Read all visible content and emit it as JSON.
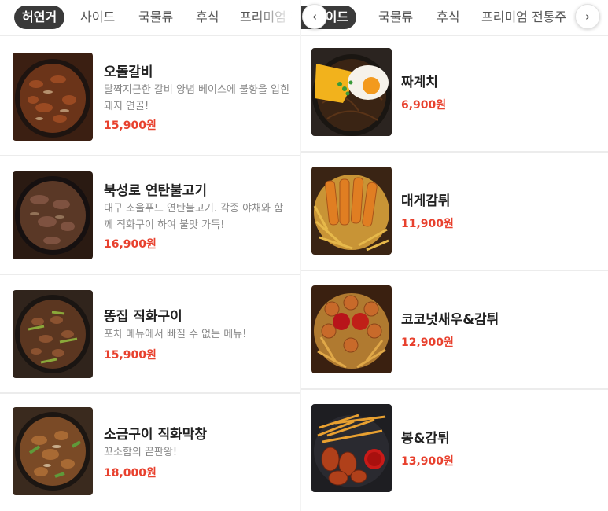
{
  "left": {
    "tabs": [
      "허연거",
      "사이드",
      "국물류",
      "후식",
      "프리미엄 전"
    ],
    "items": [
      {
        "name": "오돌갈비",
        "desc": "달짝지근한 갈비 양념 베이스에 불향을 입힌 돼지 연골!",
        "price": "15,900원",
        "image": "pork-cartilage-skillet"
      },
      {
        "name": "북성로 연탄불고기",
        "desc": "대구 소울푸드 연탄불고기. 각종 야채와 함께 직화구이 하여 불맛 가득!",
        "price": "16,900원",
        "image": "briquette-bulgogi-skillet"
      },
      {
        "name": "똥집 직화구이",
        "desc": "포차 메뉴에서 빠질 수 없는 메뉴!",
        "price": "15,900원",
        "image": "gizzard-skillet"
      },
      {
        "name": "소금구이 직화막창",
        "desc": "꼬소함의 끝판왕!",
        "price": "18,000원",
        "image": "grilled-makchang"
      }
    ]
  },
  "right": {
    "tabs": [
      "사이드",
      "국물류",
      "후식",
      "프리미엄 전통주"
    ],
    "arrows": {
      "prev": "‹",
      "next": "›"
    },
    "items": [
      {
        "name": "짜계치",
        "price": "6,900원",
        "image": "jjapaguri-egg-cheese"
      },
      {
        "name": "대게감튀",
        "price": "11,900원",
        "image": "snow-crab-fries"
      },
      {
        "name": "코코넛새우&감튀",
        "price": "12,900원",
        "image": "coconut-shrimp-fries"
      },
      {
        "name": "봉&감튀",
        "price": "13,900원",
        "image": "wings-fries"
      }
    ]
  },
  "colors": {
    "price": "#e8412e",
    "activeTab": "#3a3a3a",
    "divider": "#ececec",
    "descText": "#888888"
  }
}
